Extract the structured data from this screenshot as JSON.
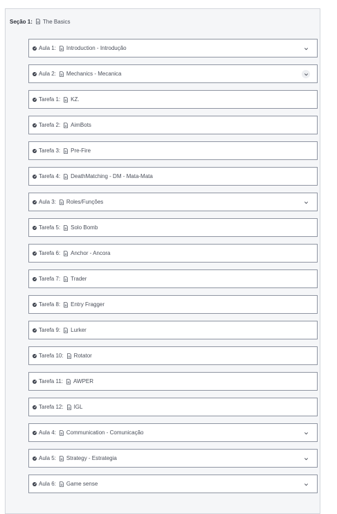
{
  "section": {
    "label": "Seção 1:",
    "title": "The Basics"
  },
  "rows": [
    {
      "kind": "Aula 1:",
      "title": "Introduction - Introdução",
      "expandable": true
    },
    {
      "kind": "Aula 2:",
      "title": "Mechanics - Mecanica",
      "expandable": true,
      "highlighted": true
    },
    {
      "kind": "Tarefa 1:",
      "title": "KZ.",
      "expandable": false
    },
    {
      "kind": "Tarefa 2:",
      "title": "AimBots",
      "expandable": false
    },
    {
      "kind": "Tarefa 3:",
      "title": "Pre-Fire",
      "expandable": false
    },
    {
      "kind": "Tarefa 4:",
      "title": "DeathMatching - DM - Mata-Mata",
      "expandable": false
    },
    {
      "kind": "Aula 3:",
      "title": "Roles/Funções",
      "expandable": true
    },
    {
      "kind": "Tarefa 5:",
      "title": "Solo Bomb",
      "expandable": false
    },
    {
      "kind": "Tarefa 6:",
      "title": "Anchor - Ancora",
      "expandable": false
    },
    {
      "kind": "Tarefa 7:",
      "title": "Trader",
      "expandable": false
    },
    {
      "kind": "Tarefa 8:",
      "title": "Entry Fragger",
      "expandable": false
    },
    {
      "kind": "Tarefa 9:",
      "title": "Lurker",
      "expandable": false
    },
    {
      "kind": "Tarefa 10:",
      "title": "Rotator",
      "expandable": false
    },
    {
      "kind": "Tarefa 11:",
      "title": "AWPER",
      "expandable": false
    },
    {
      "kind": "Tarefa 12:",
      "title": "IGL",
      "expandable": false
    },
    {
      "kind": "Aula 4:",
      "title": "Communication - Comunicação",
      "expandable": true
    },
    {
      "kind": "Aula 5:",
      "title": "Strategy - Estrategia",
      "expandable": true
    },
    {
      "kind": "Aula 6:",
      "title": "Game sense",
      "expandable": true
    }
  ]
}
